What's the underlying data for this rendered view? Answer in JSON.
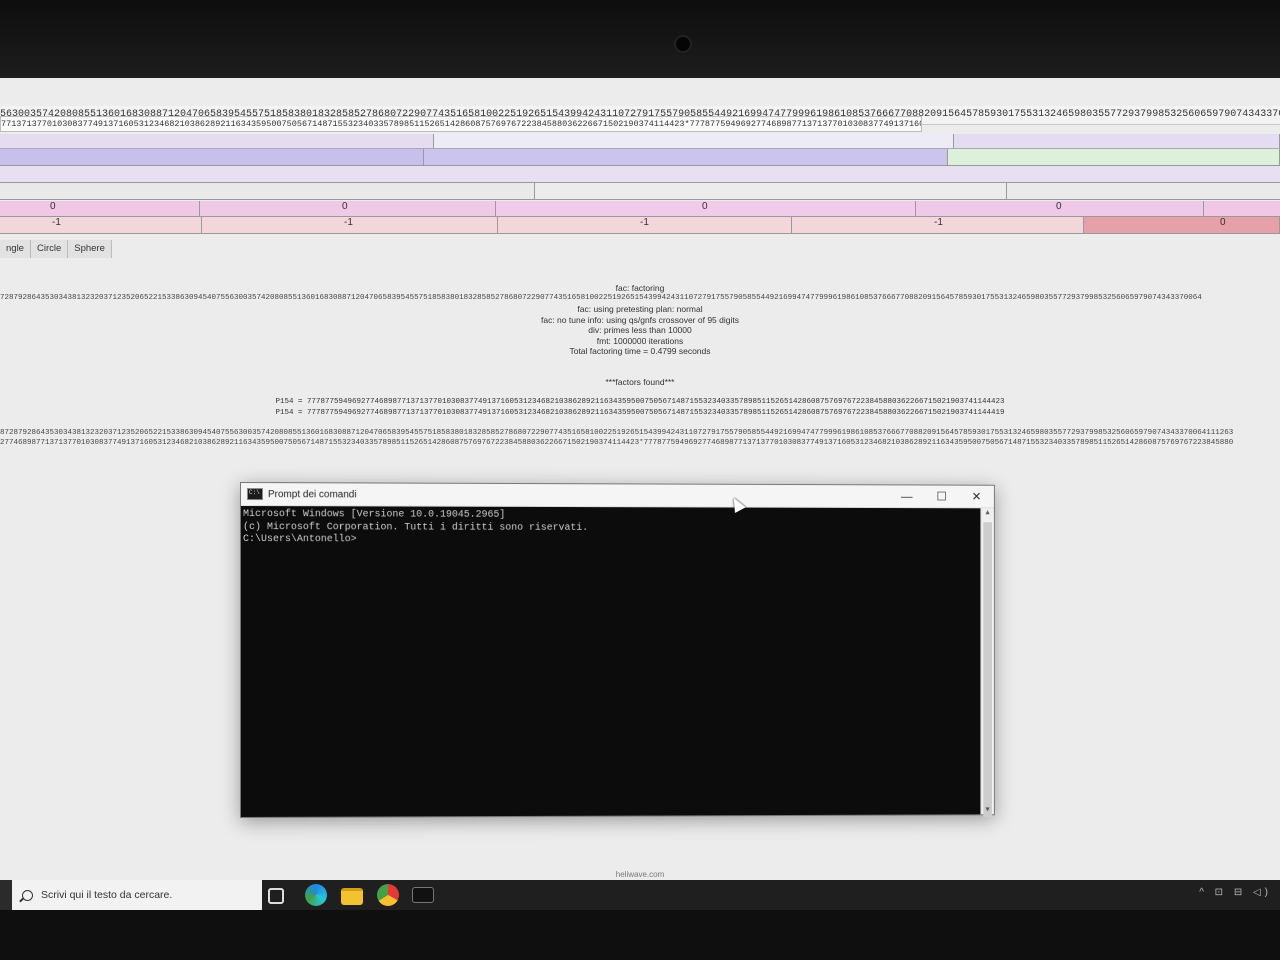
{
  "calculator": {
    "input_line_1": "5630035742080855136016830887120470658395455751858380183285852786807229077435165810022519265154399424311072791755790585544921699474779996198610853766677088209156457859301755313246598035577293799853256065979074343370064111263",
    "input_line_2": "77137137701030837749137160531234682103862892116343595007505671487155323403357898511526514286087576976722384588036226671502190374114423*7778775949692774689877137137701030837749137160531234",
    "bar_row_values": [
      "0",
      "0",
      "0",
      "0"
    ],
    "bar_row2_values": [
      "-1",
      "-1",
      "-1",
      "-1",
      "0"
    ],
    "tabs": [
      "ngle",
      "Circle",
      "Sphere"
    ],
    "output": {
      "lines": [
        "fac: factoring",
        "fac: using pretesting plan: normal",
        "fac: no tune info: using qs/gnfs crossover of 95 digits",
        "div: primes less than 10000",
        "fmt: 1000000 iterations",
        "Total factoring time = 0.4799 seconds"
      ],
      "long_line": "728792864353034381323203712352065221533863094540755630035742080855136016830887120470658395455751858380183285852786807229077435165810022519265154399424311072791755790585544921699474779996198610853766677088209156457859301755313246598035577293799853256065979074343370064",
      "factors_header": "***factors found***",
      "factors": [
        "P154 = 77787759496927746898771371377010308377491371605312346821038628921163435950075056714871553234033578985115265142860875769767223845880362266715021903741144423",
        "P154 = 77787759496927746898771371377010308377491371605312346821038628921163435950075056714871553234033578985115265142860875769767223845880362266715021903741144419"
      ],
      "tail_line_1": "8728792864353034381323203712352065221533863094540755630035742080855136016830887120470658395455751858380183285852786807229077435165810022519265154399424311072791755790585544921699474779996198610853766677088209156457859301755313246598035577293799853256065979074343370064111263",
      "tail_line_2": "2774689877137137701030837749137160531234682103862892116343595007505671487155323403357898511526514286087576976722384588036226671502190374114423*77787759496927746898771371377010308377491371605312346821038628921163435950075056714871553234033578985115265142860875769767223845880"
    },
    "credit": "heliwave.com"
  },
  "cmd": {
    "title": "Prompt dei comandi",
    "lines": [
      "Microsoft Windows [Versione 10.0.19045.2965]",
      "(c) Microsoft Corporation. Tutti i diritti sono riservati.",
      "",
      "C:\\Users\\Antonello>"
    ],
    "minimize": "—",
    "maximize": "☐",
    "close": "✕"
  },
  "taskbar": {
    "search_placeholder": "Scrivi qui il testo da cercare.",
    "icons": [
      "task-view-icon",
      "edge-icon",
      "file-explorer-icon",
      "chrome-icon",
      "cmd-icon"
    ],
    "tray": "^ ⊡ ⊟ ◁)"
  },
  "colors": {
    "purple_bar": "#c8c0ec",
    "pink_bar": "#f0c8e6",
    "red_bar": "#e6a0a8",
    "cmd_bg": "#0c0c0c"
  }
}
